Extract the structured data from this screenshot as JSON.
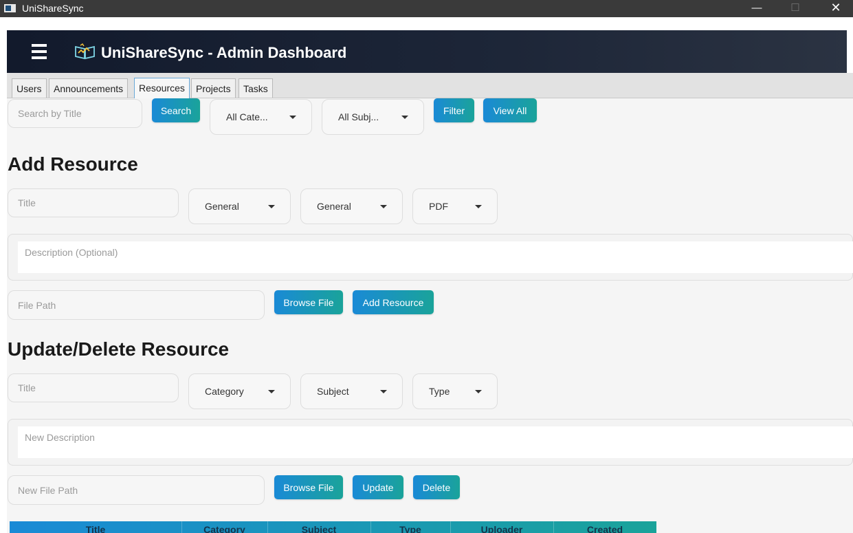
{
  "window": {
    "title": "UniShareSync",
    "minimize": "—",
    "maximize": "☐",
    "close": "✕"
  },
  "header": {
    "title": "UniShareSync - Admin Dashboard"
  },
  "tabs": [
    {
      "label": "Users"
    },
    {
      "label": "Announcements"
    },
    {
      "label": "Resources"
    },
    {
      "label": "Projects"
    },
    {
      "label": "Tasks"
    }
  ],
  "active_tab": "Resources",
  "search": {
    "placeholder": "Search by Title",
    "search_button": "Search",
    "category_value": "All Cate...",
    "subject_value": "All Subj...",
    "filter_button": "Filter",
    "view_all_button": "View All"
  },
  "add_resource": {
    "heading": "Add Resource",
    "title_placeholder": "Title",
    "category_value": "General",
    "subject_value": "General",
    "type_value": "PDF",
    "description_placeholder": "Description (Optional)",
    "file_path_placeholder": "File Path",
    "browse_button": "Browse File",
    "add_button": "Add Resource"
  },
  "update_resource": {
    "heading": "Update/Delete Resource",
    "title_placeholder": "Title",
    "category_value": "Category",
    "subject_value": "Subject",
    "type_value": "Type",
    "description_placeholder": "New Description",
    "file_path_placeholder": "New File Path",
    "browse_button": "Browse File",
    "update_button": "Update",
    "delete_button": "Delete"
  },
  "table": {
    "columns": [
      "Title",
      "Category",
      "Subject",
      "Type",
      "Uploader",
      "Created"
    ]
  },
  "colors": {
    "accent_start": "#1a8ad6",
    "accent_end": "#1aa39a",
    "header_bg": "#121a2c"
  }
}
